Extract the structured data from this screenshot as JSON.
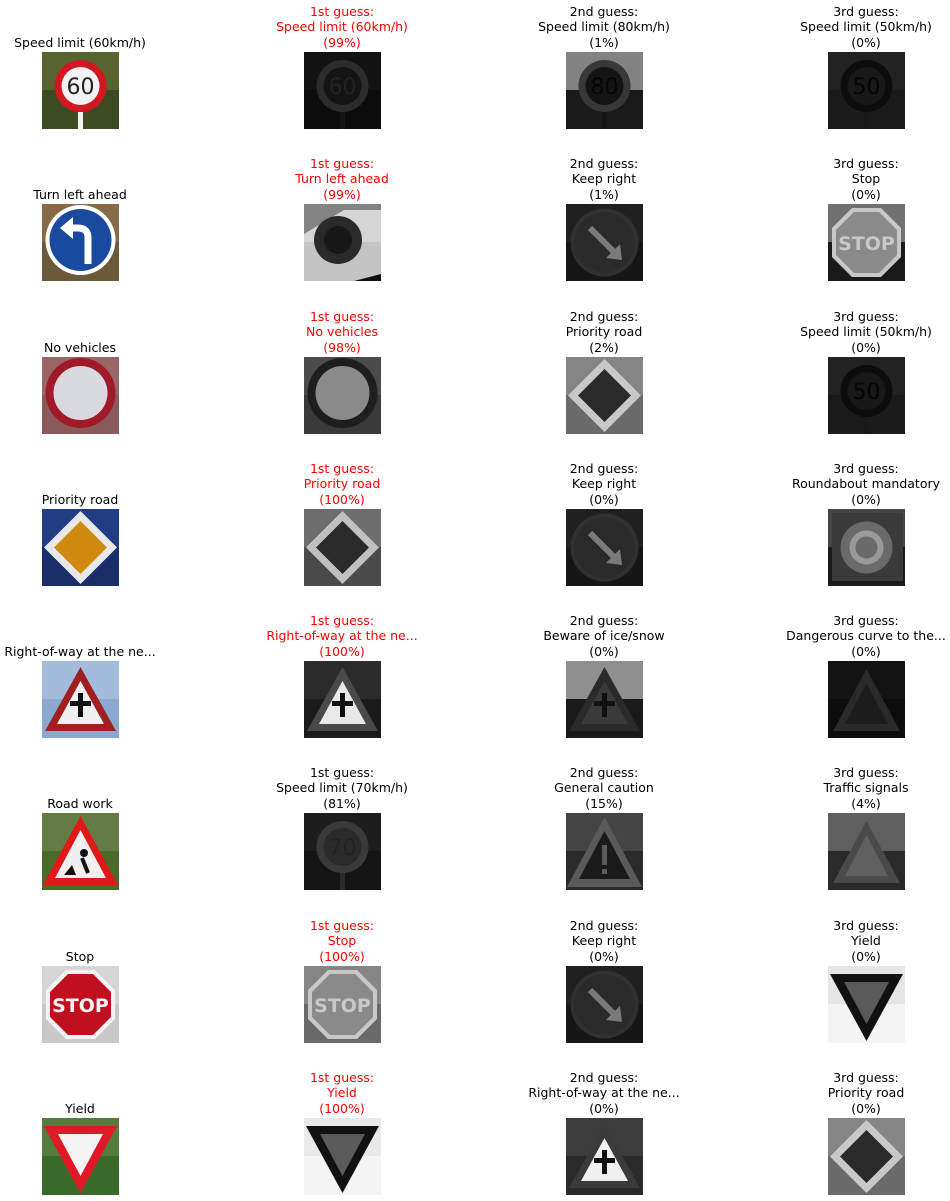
{
  "rows": [
    {
      "input": {
        "label": "Speed limit (60km/h)",
        "kind": "speed",
        "text": "60",
        "colors": [
          "#3e4a22",
          "#6b7a3a",
          "#d01820",
          "#f2f2f2"
        ]
      },
      "guesses": [
        {
          "line1": "1st guess:",
          "line2": "Speed limit (60km/h)",
          "line3": "(99%)",
          "correct": true,
          "kind": "speed",
          "text": "60",
          "colors": [
            "#0c0c0c",
            "#181818",
            "#2c2c2c",
            "#141414"
          ]
        },
        {
          "line1": "2nd guess:",
          "line2": "Speed limit (80km/h)",
          "line3": "(1%)",
          "correct": false,
          "kind": "speed",
          "text": "80",
          "colors": [
            "#1a1a1a",
            "#d8d8d8",
            "#383838",
            "#141414"
          ]
        },
        {
          "line1": "3rd guess:",
          "line2": "Speed limit (50km/h)",
          "line3": "(0%)",
          "correct": false,
          "kind": "speed",
          "text": "50",
          "colors": [
            "#1a1a1a",
            "#2a2a2a",
            "#0c0c0c",
            "#181818"
          ]
        }
      ]
    },
    {
      "input": {
        "label": "Turn left ahead",
        "kind": "turnleft",
        "text": "",
        "colors": [
          "#6a5a3a",
          "#9a7a52",
          "#1a4aa0",
          "#ffffff"
        ]
      },
      "guesses": [
        {
          "line1": "1st guess:",
          "line2": "Turn left ahead",
          "line3": "(99%)",
          "correct": true,
          "kind": "disc",
          "text": "",
          "colors": [
            "#0e0e0e",
            "#e4e4e4",
            "#2a2a2a",
            "#181818"
          ]
        },
        {
          "line1": "2nd guess:",
          "line2": "Keep right",
          "line3": "(1%)",
          "correct": false,
          "kind": "keepright",
          "text": "",
          "colors": [
            "#161616",
            "#2a2a2a",
            "#303030",
            "#7a7a7a"
          ]
        },
        {
          "line1": "3rd guess:",
          "line2": "Stop",
          "line3": "(0%)",
          "correct": false,
          "kind": "stop",
          "text": "STOP",
          "colors": [
            "#1a1a1a",
            "#b8b8b8",
            "#8a8a8a",
            "#c8c8c8"
          ]
        }
      ]
    },
    {
      "input": {
        "label": "No vehicles",
        "kind": "novehicles",
        "text": "",
        "colors": [
          "#8a5a5a",
          "#a87070",
          "#a01a2a",
          "#d8dae0"
        ]
      },
      "guesses": [
        {
          "line1": "1st guess:",
          "line2": "No vehicles",
          "line3": "(98%)",
          "correct": true,
          "kind": "novehicles",
          "text": "",
          "colors": [
            "#3a3a3a",
            "#5a5a5a",
            "#1e1e1e",
            "#8a8a8a"
          ]
        },
        {
          "line1": "2nd guess:",
          "line2": "Priority road",
          "line3": "(2%)",
          "correct": false,
          "kind": "priority",
          "text": "",
          "colors": [
            "#6a6a6a",
            "#9a9a9a",
            "#c8c8c8",
            "#2a2a2a"
          ]
        },
        {
          "line1": "3rd guess:",
          "line2": "Speed limit (50km/h)",
          "line3": "(0%)",
          "correct": false,
          "kind": "speed",
          "text": "50",
          "colors": [
            "#1a1a1a",
            "#2a2a2a",
            "#0c0c0c",
            "#181818"
          ]
        }
      ]
    },
    {
      "input": {
        "label": "Priority road",
        "kind": "priority",
        "text": "",
        "colors": [
          "#1a2e6a",
          "#2a4a9a",
          "#e8e8e8",
          "#d08a10"
        ]
      },
      "guesses": [
        {
          "line1": "1st guess:",
          "line2": "Priority road",
          "line3": "(100%)",
          "correct": true,
          "kind": "priority",
          "text": "",
          "colors": [
            "#4a4a4a",
            "#8a8a8a",
            "#c0c0c0",
            "#2a2a2a"
          ]
        },
        {
          "line1": "2nd guess:",
          "line2": "Keep right",
          "line3": "(0%)",
          "correct": false,
          "kind": "keepright",
          "text": "",
          "colors": [
            "#161616",
            "#2a2a2a",
            "#303030",
            "#7a7a7a"
          ]
        },
        {
          "line1": "3rd guess:",
          "line2": "Roundabout mandatory",
          "line3": "(0%)",
          "correct": false,
          "kind": "roundabout",
          "text": "",
          "colors": [
            "#1a1a1a",
            "#6a6a6a",
            "#3a3a3a",
            "#9a9a9a"
          ]
        }
      ]
    },
    {
      "input": {
        "label": "Right-of-way at the ne...",
        "kind": "rightofway",
        "text": "",
        "colors": [
          "#8aa8d0",
          "#b8cce4",
          "#a02020",
          "#f0f0f0"
        ]
      },
      "guesses": [
        {
          "line1": "1st guess:",
          "line2": "Right-of-way at the ne...",
          "line3": "(100%)",
          "correct": true,
          "kind": "rightofway",
          "text": "",
          "colors": [
            "#1a1a1a",
            "#3a3a3a",
            "#4a4a4a",
            "#e8e8e8"
          ]
        },
        {
          "line1": "2nd guess:",
          "line2": "Beware of ice/snow",
          "line3": "(0%)",
          "correct": false,
          "kind": "rightofway",
          "text": "",
          "colors": [
            "#1a1a1a",
            "#f0f0f0",
            "#2a2a2a",
            "#3a3a3a"
          ]
        },
        {
          "line1": "3rd guess:",
          "line2": "Dangerous curve to the...",
          "line3": "(0%)",
          "correct": false,
          "kind": "warning",
          "text": "",
          "colors": [
            "#0c0c0c",
            "#1a1a1a",
            "#2a2a2a",
            "#181818"
          ]
        }
      ]
    },
    {
      "input": {
        "label": "Road work",
        "kind": "roadwork",
        "text": "",
        "colors": [
          "#4a6a2a",
          "#7a8a5a",
          "#e01818",
          "#f0f0f0"
        ]
      },
      "guesses": [
        {
          "line1": "1st guess:",
          "line2": "Speed limit (70km/h)",
          "line3": "(81%)",
          "correct": false,
          "kind": "speed",
          "text": "70",
          "colors": [
            "#141414",
            "#242424",
            "#3a3a3a",
            "#2a2a2a"
          ]
        },
        {
          "line1": "2nd guess:",
          "line2": "General caution",
          "line3": "(15%)",
          "correct": false,
          "kind": "caution",
          "text": "",
          "colors": [
            "#2a2a2a",
            "#5a5a5a",
            "#1a1a1a",
            "#3a3a3a"
          ]
        },
        {
          "line1": "3rd guess:",
          "line2": "Traffic signals",
          "line3": "(4%)",
          "correct": false,
          "kind": "warning",
          "text": "",
          "colors": [
            "#2a2a2a",
            "#8a8a8a",
            "#4a4a4a",
            "#6a6a6a"
          ]
        }
      ]
    },
    {
      "input": {
        "label": "Stop",
        "kind": "stop",
        "text": "STOP",
        "colors": [
          "#c8c8c8",
          "#e0e0e0",
          "#c01020",
          "#f4f4f4"
        ]
      },
      "guesses": [
        {
          "line1": "1st guess:",
          "line2": "Stop",
          "line3": "(100%)",
          "correct": true,
          "kind": "stop",
          "text": "STOP",
          "colors": [
            "#6a6a6a",
            "#9a9a9a",
            "#8a8a8a",
            "#c8c8c8"
          ]
        },
        {
          "line1": "2nd guess:",
          "line2": "Keep right",
          "line3": "(0%)",
          "correct": false,
          "kind": "keepright",
          "text": "",
          "colors": [
            "#161616",
            "#2a2a2a",
            "#303030",
            "#7a7a7a"
          ]
        },
        {
          "line1": "3rd guess:",
          "line2": "Yield",
          "line3": "(0%)",
          "correct": false,
          "kind": "yield",
          "text": "",
          "colors": [
            "#f4f4f4",
            "#d8d8d8",
            "#111111",
            "#5a5a5a"
          ]
        }
      ]
    },
    {
      "input": {
        "label": "Yield",
        "kind": "yield",
        "text": "",
        "colors": [
          "#3a6a2a",
          "#6a8a4a",
          "#e01828",
          "#f4f4f4"
        ]
      },
      "guesses": [
        {
          "line1": "1st guess:",
          "line2": "Yield",
          "line3": "(100%)",
          "correct": true,
          "kind": "yield",
          "text": "",
          "colors": [
            "#f4f4f4",
            "#e0e0e0",
            "#111111",
            "#5a5a5a"
          ]
        },
        {
          "line1": "2nd guess:",
          "line2": "Right-of-way at the ne...",
          "line3": "(0%)",
          "correct": false,
          "kind": "rightofway",
          "text": "",
          "colors": [
            "#2a2a2a",
            "#4a4a4a",
            "#3a3a3a",
            "#f0f0f0"
          ]
        },
        {
          "line1": "3rd guess:",
          "line2": "Priority road",
          "line3": "(0%)",
          "correct": false,
          "kind": "priority",
          "text": "",
          "colors": [
            "#6a6a6a",
            "#9a9a9a",
            "#c8c8c8",
            "#2a2a2a"
          ]
        }
      ]
    }
  ]
}
